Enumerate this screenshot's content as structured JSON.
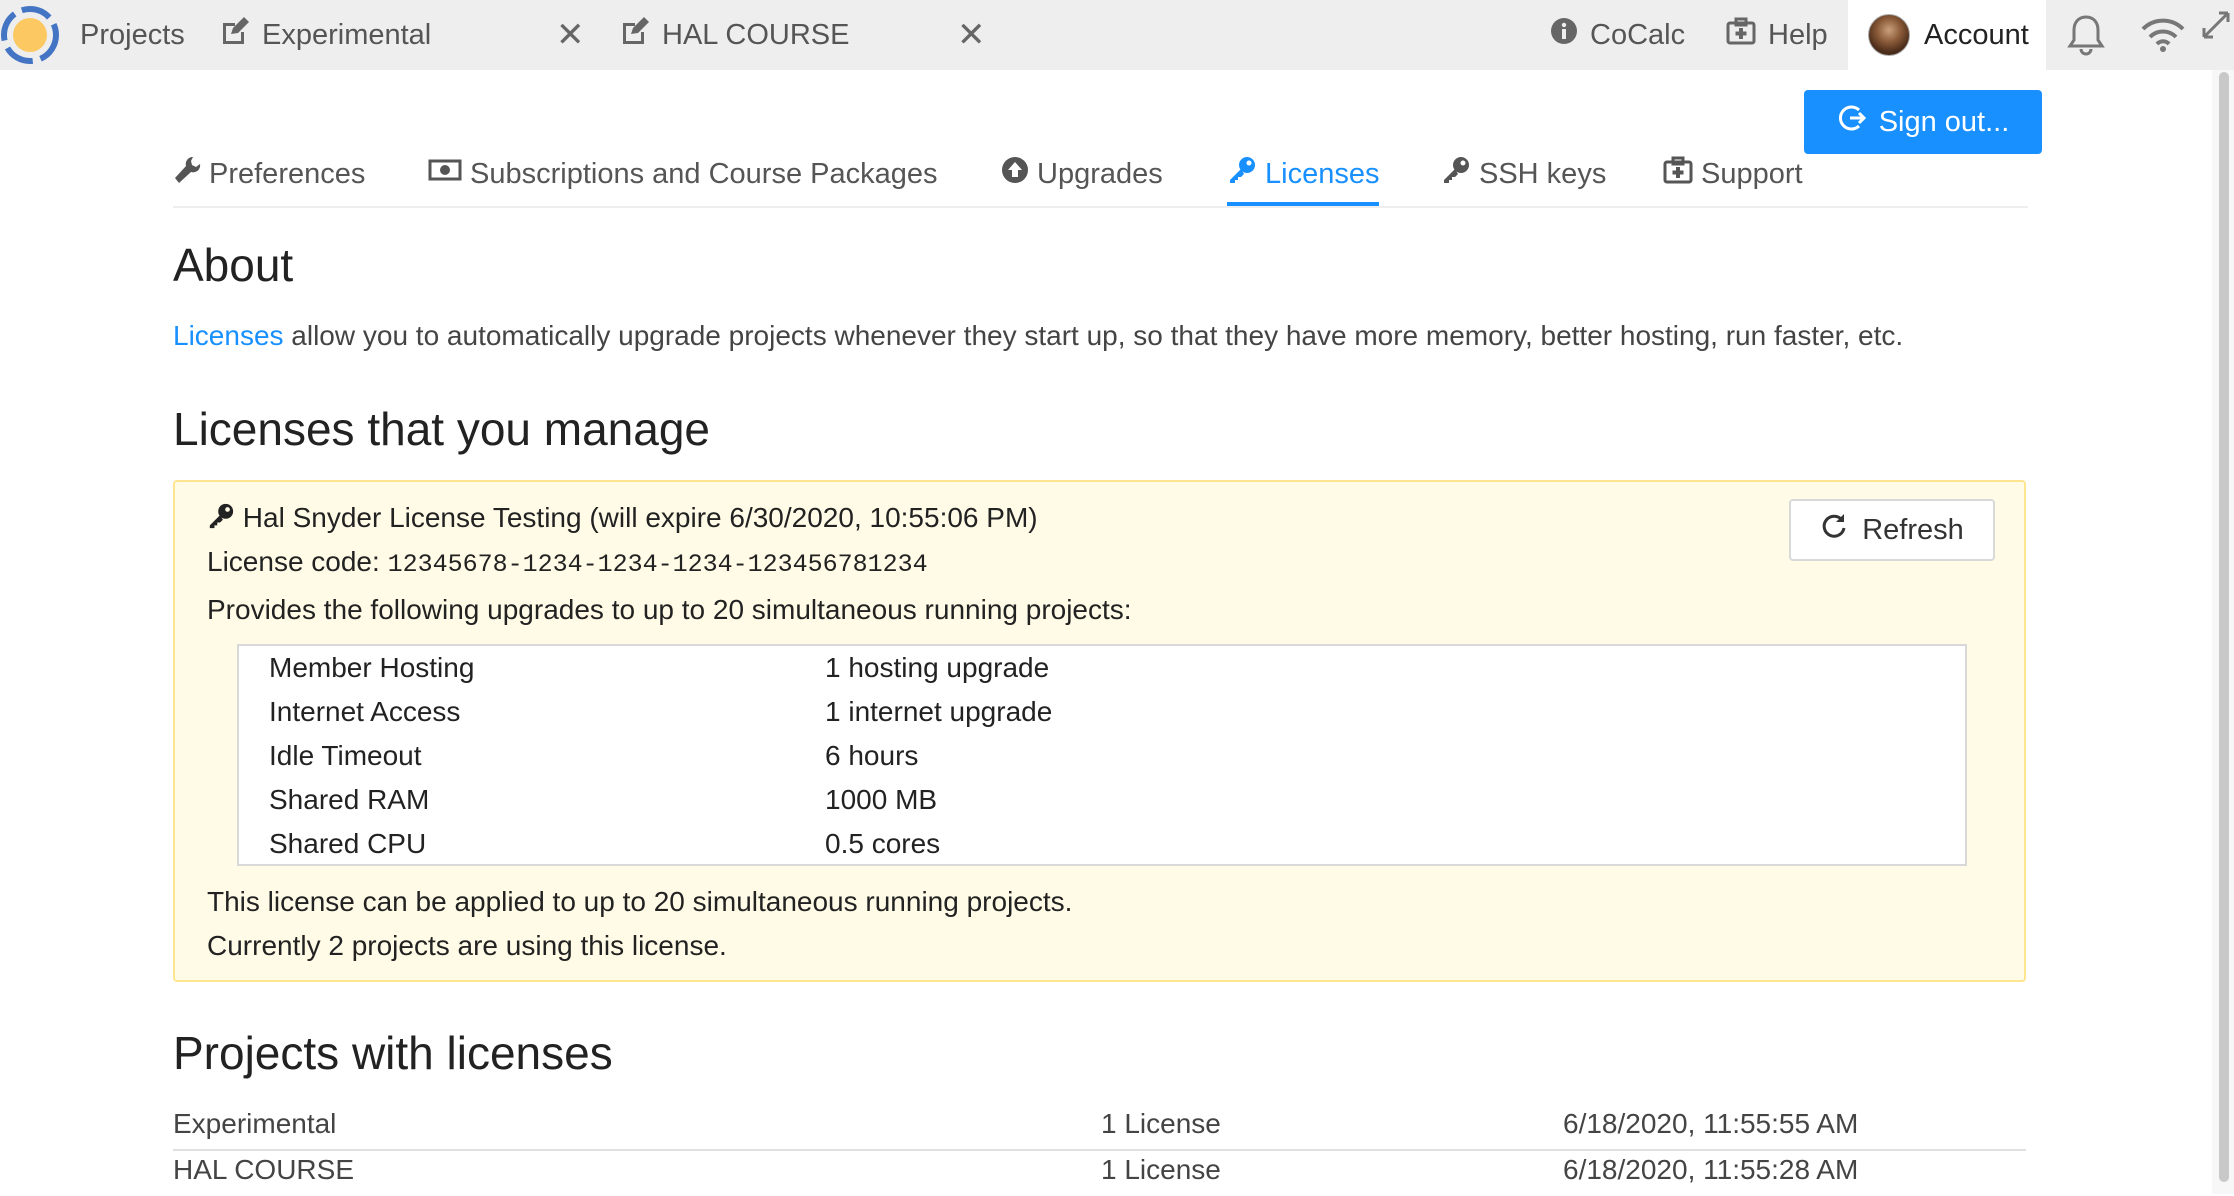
{
  "topbar": {
    "projects_label": "Projects",
    "tabs": [
      {
        "label": "Experimental",
        "icon": "edit-icon"
      },
      {
        "label": "HAL COURSE",
        "icon": "edit-icon"
      }
    ],
    "close_glyph": "✕",
    "cocalc_label": "CoCalc",
    "help_label": "Help",
    "account_label": "Account"
  },
  "signout_label": "Sign out...",
  "subtabs": [
    {
      "label": "Preferences",
      "icon": "wrench-icon"
    },
    {
      "label": "Subscriptions and Course Packages",
      "icon": "money-icon"
    },
    {
      "label": "Upgrades",
      "icon": "arrow-circle-up-icon"
    },
    {
      "label": "Licenses",
      "icon": "key-icon",
      "active": true
    },
    {
      "label": "SSH keys",
      "icon": "key-icon"
    },
    {
      "label": "Support",
      "icon": "medkit-icon"
    }
  ],
  "about": {
    "heading": "About",
    "link_text": "Licenses",
    "text": " allow you to automatically upgrade projects whenever they start up, so that they have more memory, better hosting, run faster, etc."
  },
  "manage": {
    "heading": "Licenses that you manage",
    "license": {
      "title": "Hal Snyder License Testing (will expire 6/30/2020, 10:55:06 PM)",
      "code_label": "License code: ",
      "code": "12345678-1234-1234-1234-123456781234",
      "provides": "Provides the following upgrades to up to 20 simultaneous running projects:",
      "upgrades": [
        {
          "name": "Member Hosting",
          "value": "1 hosting upgrade"
        },
        {
          "name": "Internet Access",
          "value": "1 internet upgrade"
        },
        {
          "name": "Idle Timeout",
          "value": "6 hours"
        },
        {
          "name": "Shared RAM",
          "value": "1000 MB"
        },
        {
          "name": "Shared CPU",
          "value": "0.5 cores"
        }
      ],
      "applied_text": "This license can be applied to up to 20 simultaneous running projects.",
      "usage_text": "Currently 2 projects are using this license.",
      "refresh_label": "Refresh"
    }
  },
  "projects": {
    "heading": "Projects with licenses",
    "rows": [
      {
        "name": "Experimental",
        "licenses": "1 License",
        "date": "6/18/2020, 11:55:55 AM"
      },
      {
        "name": "HAL COURSE",
        "licenses": "1 License",
        "date": "6/18/2020, 11:55:28 AM"
      }
    ]
  },
  "colors": {
    "accent": "#1890ff",
    "card_bg": "#fffbe6",
    "card_border": "#ffe58f",
    "topbar_bg": "#eeeeee"
  }
}
